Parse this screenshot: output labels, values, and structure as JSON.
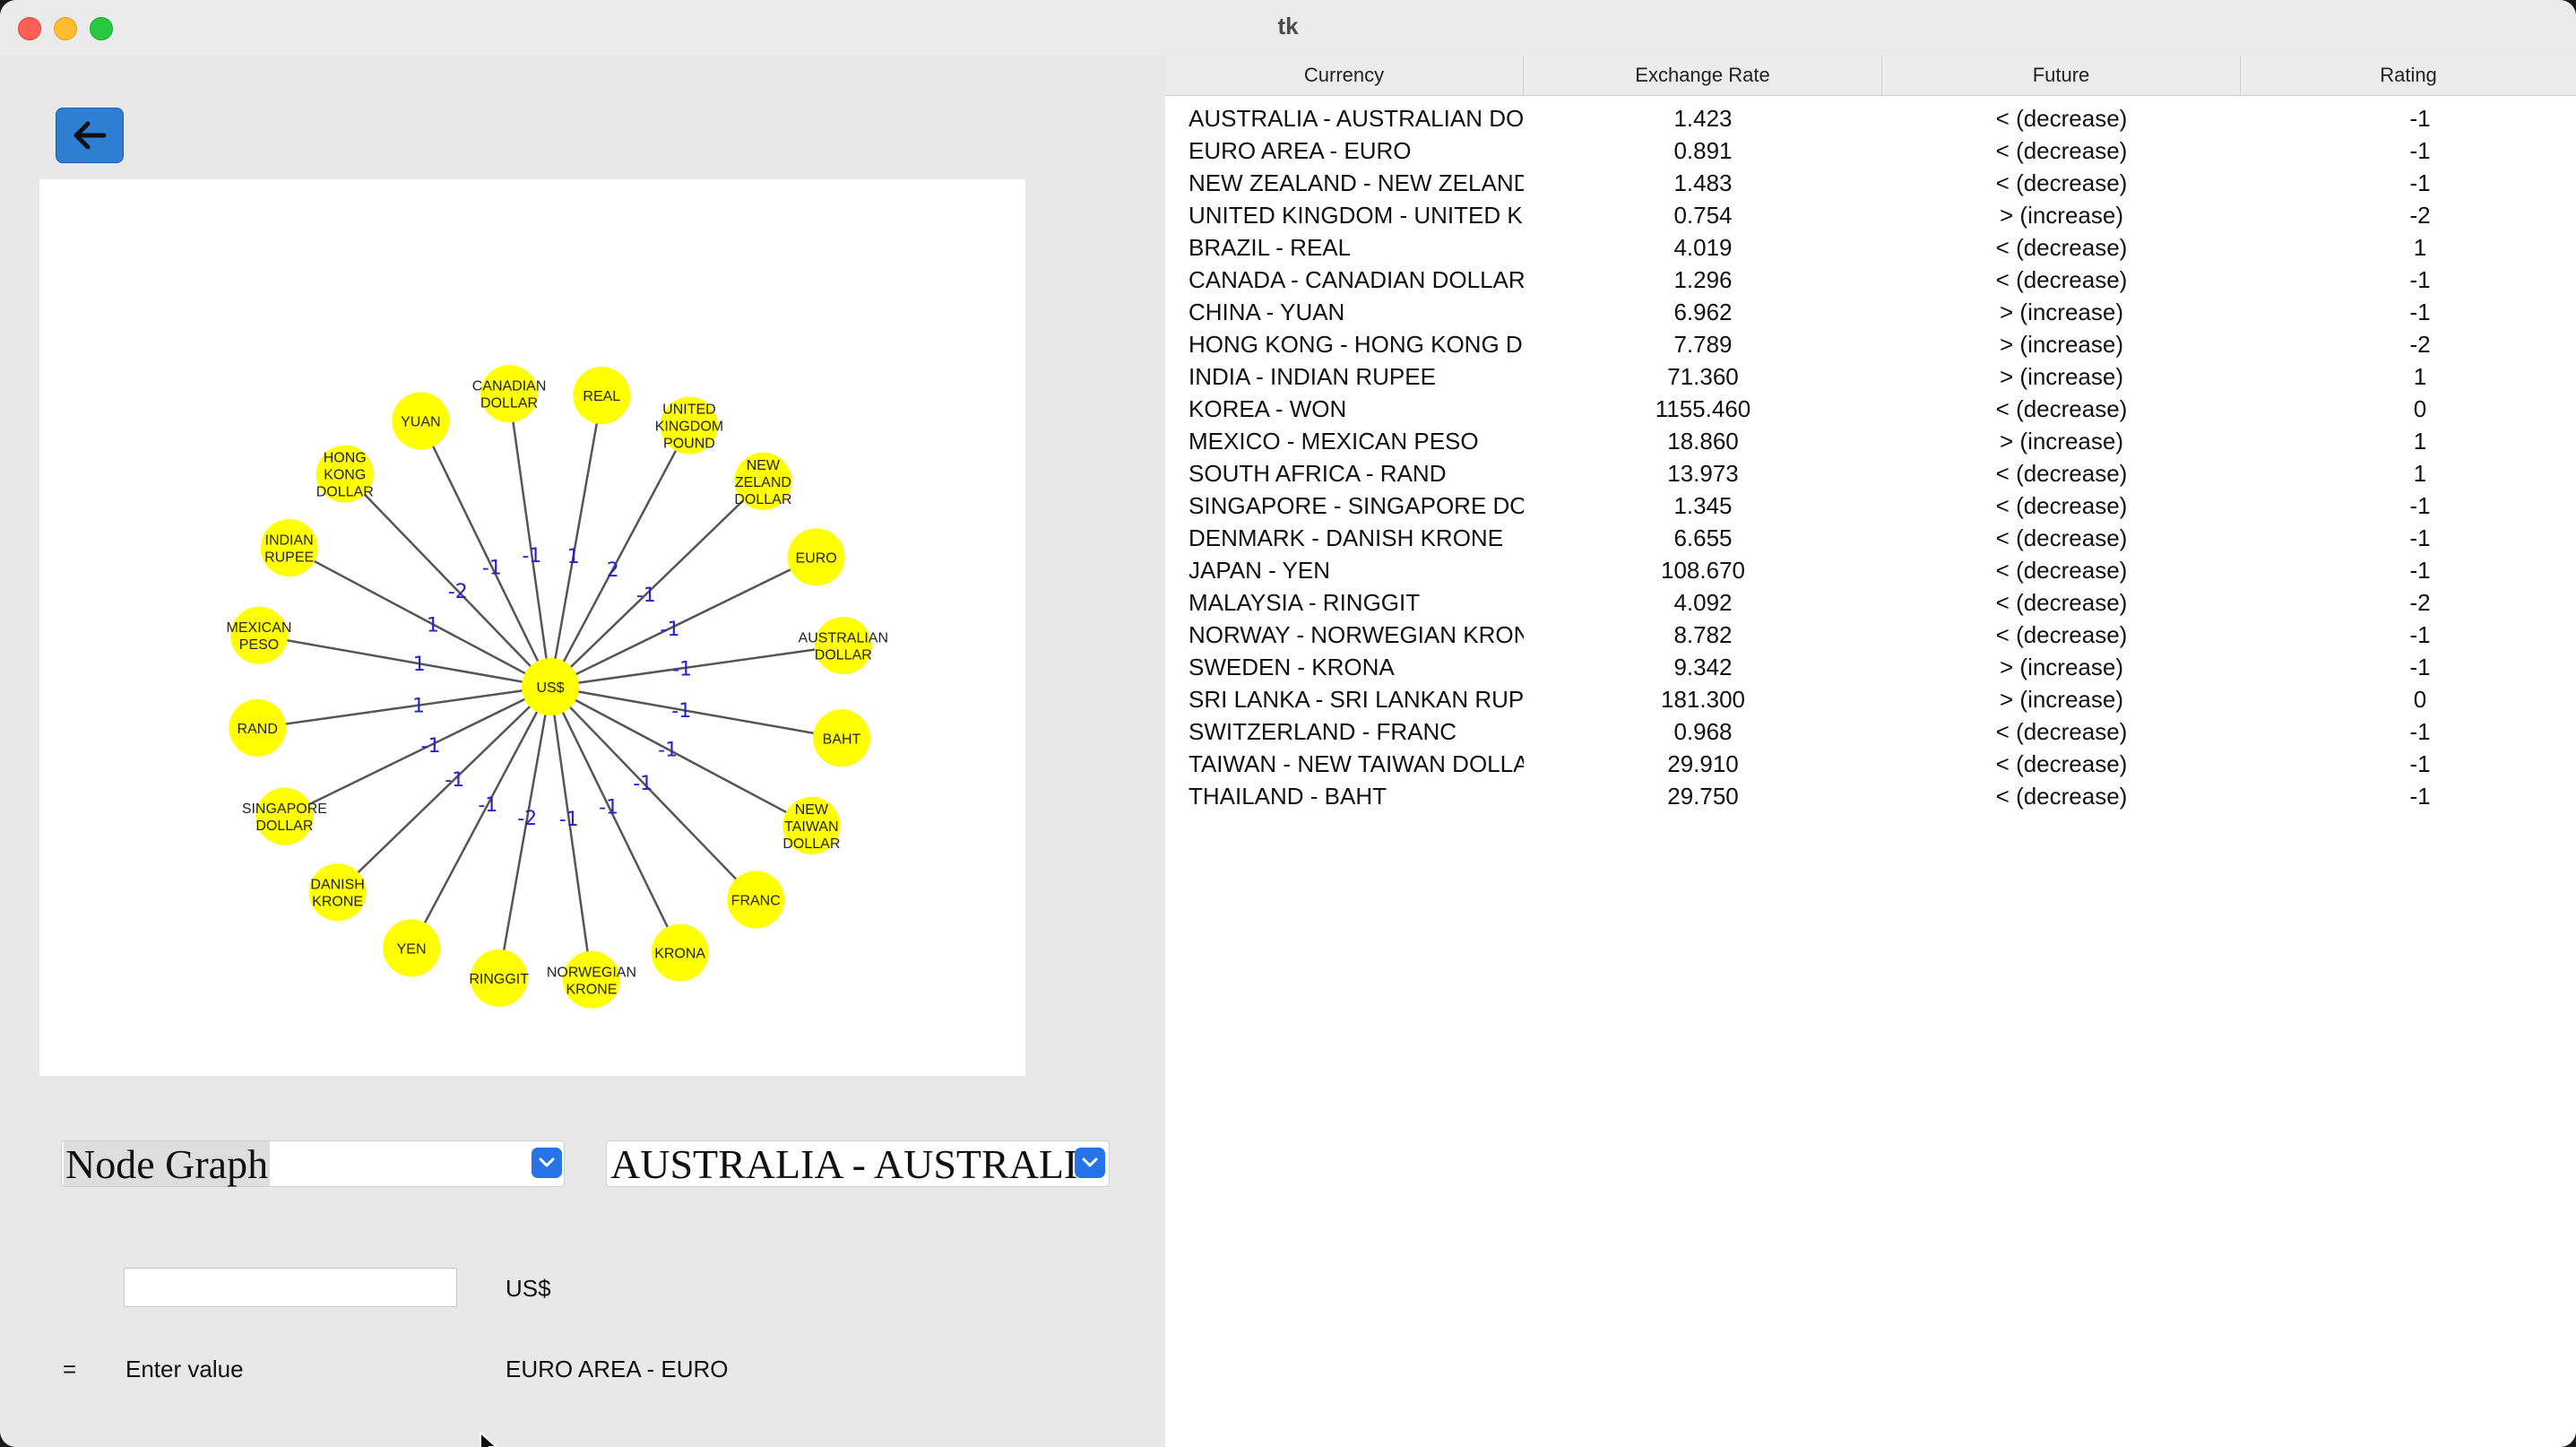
{
  "window": {
    "title": "tk"
  },
  "graph": {
    "center": "US$",
    "nodes": [
      {
        "label": "REAL",
        "rating": "1"
      },
      {
        "label": "UNITED KINGDOM POUND",
        "rating": "2"
      },
      {
        "label": "NEW ZELAND DOLLAR",
        "rating": "-1"
      },
      {
        "label": "EURO",
        "rating": "-1"
      },
      {
        "label": "AUSTRALIAN DOLLAR",
        "rating": "-1"
      },
      {
        "label": "BAHT",
        "rating": "-1"
      },
      {
        "label": "NEW TAIWAN DOLLAR",
        "rating": "-1"
      },
      {
        "label": "FRANC",
        "rating": "-1"
      },
      {
        "label": "KRONA",
        "rating": "-1"
      },
      {
        "label": "NORWEGIAN KRONE",
        "rating": "-1"
      },
      {
        "label": "RINGGIT",
        "rating": "-2"
      },
      {
        "label": "YEN",
        "rating": "-1"
      },
      {
        "label": "DANISH KRONE",
        "rating": "-1"
      },
      {
        "label": "SINGAPORE DOLLAR",
        "rating": "-1"
      },
      {
        "label": "RAND",
        "rating": "1"
      },
      {
        "label": "MEXICAN PESO",
        "rating": "1"
      },
      {
        "label": "INDIAN RUPEE",
        "rating": "1"
      },
      {
        "label": "HONG KONG DOLLAR",
        "rating": "-2"
      },
      {
        "label": "YUAN",
        "rating": "-1"
      },
      {
        "label": "CANADIAN DOLLAR",
        "rating": "-1"
      }
    ]
  },
  "controls": {
    "view_select": "Node Graph",
    "currency_select": "AUSTRALIA - AUSTRALIAN DOLLAR",
    "amount_value": "",
    "base_currency": "US$",
    "equals": "=",
    "result": "Enter value",
    "target_currency": "EURO AREA - EURO"
  },
  "table": {
    "columns": [
      "Currency",
      "Exchange Rate",
      "Future",
      "Rating"
    ],
    "rows": [
      [
        "AUSTRALIA - AUSTRALIAN DOLLAR",
        "1.423",
        "< (decrease)",
        "-1"
      ],
      [
        "EURO AREA - EURO",
        "0.891",
        "< (decrease)",
        "-1"
      ],
      [
        "NEW ZEALAND - NEW ZELAND DOLLAR",
        "1.483",
        "< (decrease)",
        "-1"
      ],
      [
        "UNITED KINGDOM - UNITED KINGDOM POUND",
        "0.754",
        "> (increase)",
        "-2"
      ],
      [
        "BRAZIL - REAL",
        "4.019",
        "< (decrease)",
        "1"
      ],
      [
        "CANADA - CANADIAN DOLLAR",
        "1.296",
        "< (decrease)",
        "-1"
      ],
      [
        "CHINA - YUAN",
        "6.962",
        "> (increase)",
        "-1"
      ],
      [
        "HONG KONG - HONG KONG DOLLAR",
        "7.789",
        "> (increase)",
        "-2"
      ],
      [
        "INDIA - INDIAN RUPEE",
        "71.360",
        "> (increase)",
        "1"
      ],
      [
        "KOREA - WON",
        "1155.460",
        "< (decrease)",
        "0"
      ],
      [
        "MEXICO - MEXICAN PESO",
        "18.860",
        "> (increase)",
        "1"
      ],
      [
        "SOUTH AFRICA - RAND",
        "13.973",
        "< (decrease)",
        "1"
      ],
      [
        "SINGAPORE - SINGAPORE DOLLAR",
        "1.345",
        "< (decrease)",
        "-1"
      ],
      [
        "DENMARK - DANISH KRONE",
        "6.655",
        "< (decrease)",
        "-1"
      ],
      [
        "JAPAN - YEN",
        "108.670",
        "< (decrease)",
        "-1"
      ],
      [
        "MALAYSIA - RINGGIT",
        "4.092",
        "< (decrease)",
        "-2"
      ],
      [
        "NORWAY - NORWEGIAN KRONE",
        "8.782",
        "< (decrease)",
        "-1"
      ],
      [
        "SWEDEN - KRONA",
        "9.342",
        "> (increase)",
        "-1"
      ],
      [
        "SRI LANKA - SRI LANKAN RUPEE",
        "181.300",
        "> (increase)",
        "0"
      ],
      [
        "SWITZERLAND - FRANC",
        "0.968",
        "< (decrease)",
        "-1"
      ],
      [
        "TAIWAN - NEW TAIWAN DOLLAR",
        "29.910",
        "< (decrease)",
        "-1"
      ],
      [
        "THAILAND - BAHT",
        "29.750",
        "< (decrease)",
        "-1"
      ]
    ]
  },
  "colors": {
    "node_fill": "#ffff00",
    "edge_label": "#2323c8",
    "accent": "#2e7fd4"
  }
}
